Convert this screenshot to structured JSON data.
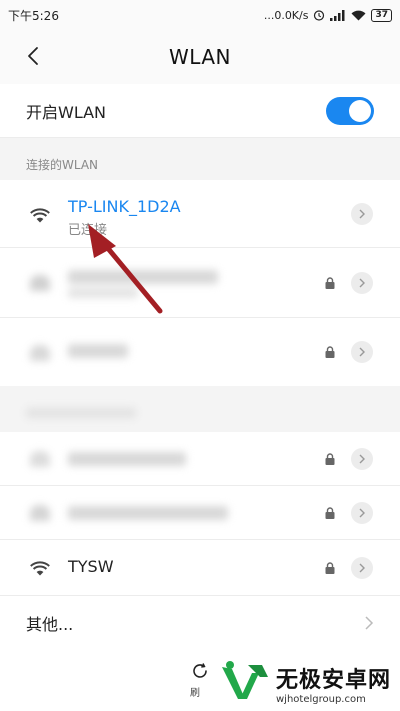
{
  "status_bar": {
    "time": "下午5:26",
    "speed": "...0.0K/s",
    "battery": "37"
  },
  "header": {
    "title": "WLAN"
  },
  "wlan_toggle": {
    "label": "开启WLAN",
    "on": true
  },
  "connected_section": {
    "label": "连接的WLAN",
    "network": {
      "name": "TP-LINK_1D2A",
      "status": "已连接"
    }
  },
  "visible_networks": [
    {
      "name": "TYSW",
      "secured": true
    }
  ],
  "other": {
    "label": "其他..."
  },
  "bottom_bar": {
    "refresh_label": "刷"
  },
  "watermark": {
    "text": "无极安卓网",
    "url": "wjhotelgroup.com"
  },
  "colors": {
    "accent": "#1a87f0",
    "connected_name": "#1a87f0",
    "annotation_arrow": "#a31f24",
    "watermark_green": "#22a84a"
  }
}
